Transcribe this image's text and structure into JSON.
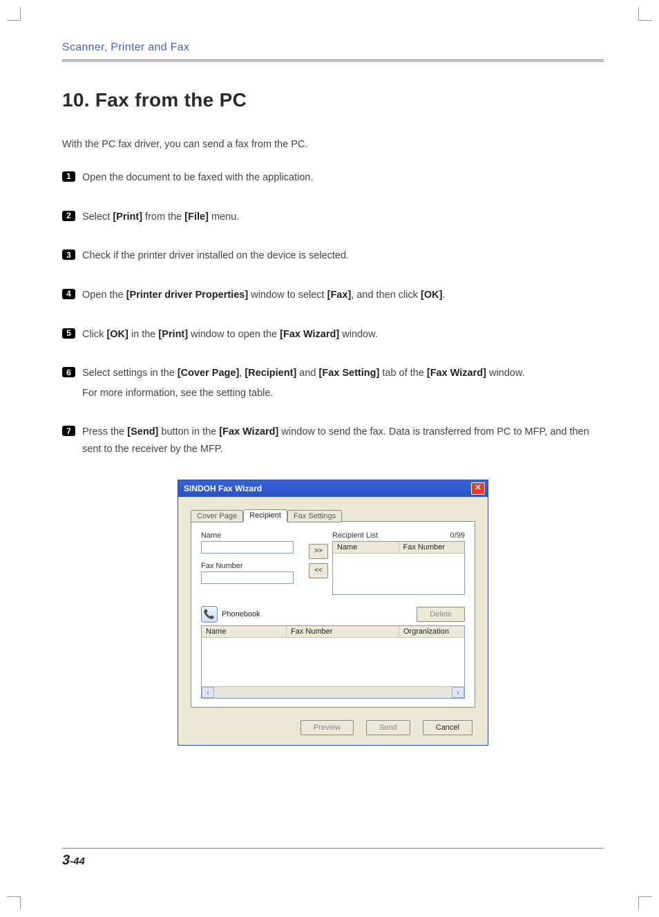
{
  "header": {
    "section": "Scanner, Printer and Fax"
  },
  "title": "10. Fax from the PC",
  "intro": "With the PC fax driver, you can send a fax from the PC.",
  "steps": {
    "s1": "Open the document to be faxed with the application.",
    "s2": {
      "a": "Select ",
      "b1": "[Print]",
      "b": " from the ",
      "b2": "[File]",
      "c": " menu."
    },
    "s3": "Check if the printer driver installed on the device is selected.",
    "s4": {
      "a": "Open the ",
      "b1": "[Printer driver Properties]",
      "b": " window to select ",
      "b2": "[Fax]",
      "c": ", and then click ",
      "b3": "[OK]",
      "d": "."
    },
    "s5": {
      "a": "Click ",
      "b1": "[OK]",
      "b": " in the ",
      "b2": "[Print]",
      "c": " window to open the ",
      "b3": "[Fax Wizard]",
      "d": " window."
    },
    "s6": {
      "a": "Select settings in the ",
      "b1": "[Cover Page]",
      "b": ", ",
      "b2": "[Recipient]",
      "c": " and ",
      "b3": "[Fax Setting]",
      "d": " tab of the ",
      "b4": "[Fax Wizard]",
      "e": " window.",
      "sub": "For more information, see the setting table."
    },
    "s7": {
      "a": "Press the ",
      "b1": "[Send]",
      "b": " button in the ",
      "b2": "[Fax Wizard]",
      "c": " window to send the fax. Data is transferred from PC to MFP, and then sent to the receiver by the MFP."
    },
    "nums": {
      "n1": "1",
      "n2": "2",
      "n3": "3",
      "n4": "4",
      "n5": "5",
      "n6": "6",
      "n7": "7"
    }
  },
  "dialog": {
    "title": "SINDOH Fax Wizard",
    "tabs": {
      "cover": "Cover Page",
      "recipient": "Recipient",
      "settings": "Fax Settings"
    },
    "name_lbl": "Name",
    "faxnum_lbl": "Fax Number",
    "add_btn": ">>",
    "remove_btn": "<<",
    "recipient_list_lbl": "Recipient List",
    "count": "0/99",
    "list_cols": {
      "name": "Name",
      "fax": "Fax Number"
    },
    "phonebook_lbl": "Phonebook",
    "delete_btn": "Delete",
    "pb_cols": {
      "name": "Name",
      "fax": "Fax Number",
      "org": "Orgranization"
    },
    "scroll_left": "‹",
    "scroll_right": "›",
    "preview_btn": "Preview",
    "send_btn": "Send",
    "cancel_btn": "Cancel",
    "phone_glyph": "📞"
  },
  "footer": {
    "chapter": "3",
    "page": "-44"
  }
}
